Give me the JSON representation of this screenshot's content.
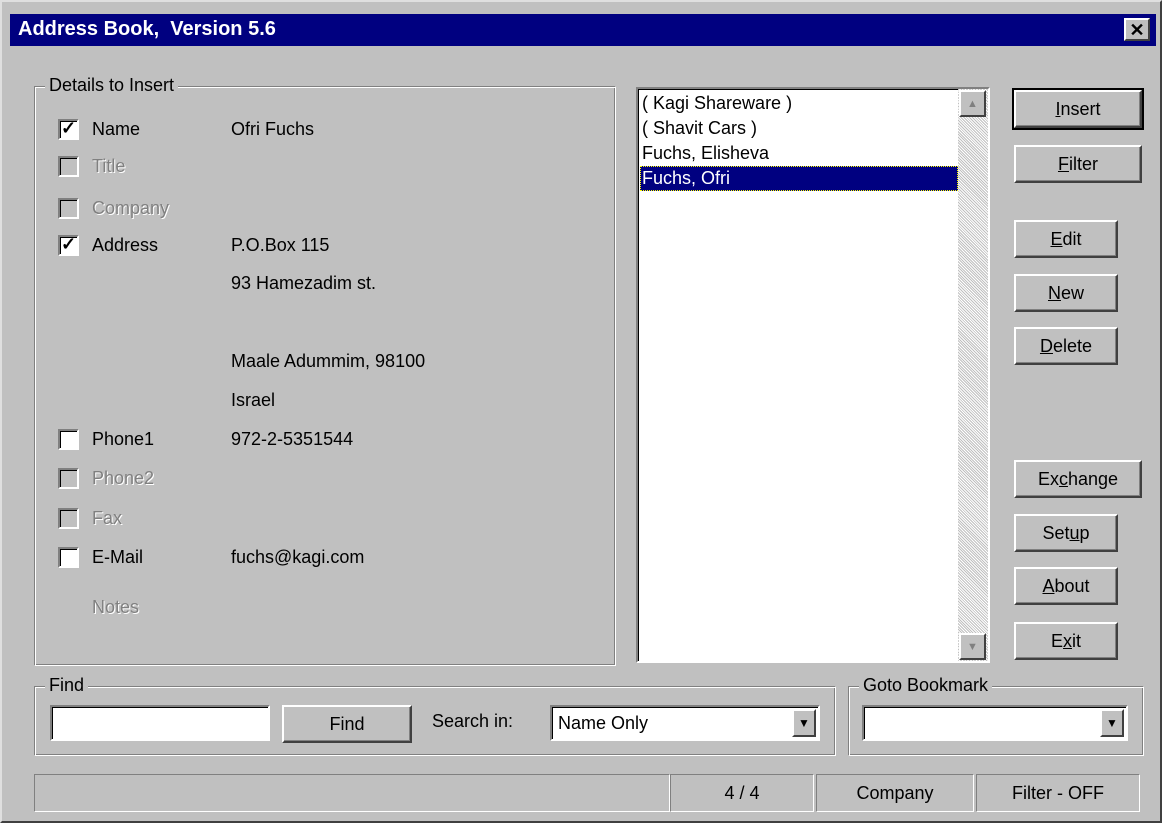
{
  "window": {
    "title": "Address Book,  Version 5.6",
    "close_glyph": "✕"
  },
  "details": {
    "legend": "Details to Insert",
    "fields": [
      {
        "label": "Name",
        "checked": true,
        "enabled": true,
        "value": "Ofri Fuchs"
      },
      {
        "label": "Title",
        "checked": false,
        "enabled": false,
        "value": ""
      },
      {
        "label": "Company",
        "checked": false,
        "enabled": false,
        "value": ""
      },
      {
        "label": "Address",
        "checked": true,
        "enabled": true,
        "value": "P.O.Box 115"
      },
      {
        "label": "Phone1",
        "checked": false,
        "enabled": true,
        "value": "972-2-5351544"
      },
      {
        "label": "Phone2",
        "checked": false,
        "enabled": false,
        "value": ""
      },
      {
        "label": "Fax",
        "checked": false,
        "enabled": false,
        "value": ""
      },
      {
        "label": "E-Mail",
        "checked": false,
        "enabled": true,
        "value": "fuchs@kagi.com"
      }
    ],
    "address_lines": [
      "93 Hamezadim st.",
      "Maale Adummim, 98100",
      "Israel"
    ],
    "notes_label": "Notes"
  },
  "contact_list": {
    "items": [
      "( Kagi Shareware )",
      "( Shavit Cars )",
      "Fuchs, Elisheva",
      "Fuchs, Ofri"
    ],
    "selected_index": 3
  },
  "buttons": {
    "insert": {
      "pre": "",
      "key": "I",
      "post": "nsert"
    },
    "filter": {
      "pre": "",
      "key": "F",
      "post": "ilter"
    },
    "edit": {
      "pre": "",
      "key": "E",
      "post": "dit"
    },
    "new": {
      "pre": "",
      "key": "N",
      "post": "ew"
    },
    "delete": {
      "pre": "",
      "key": "D",
      "post": "elete"
    },
    "exchange": {
      "pre": "Ex",
      "key": "c",
      "post": "hange"
    },
    "setup": {
      "pre": "Set",
      "key": "u",
      "post": "p"
    },
    "about": {
      "pre": "",
      "key": "A",
      "post": "bout"
    },
    "exit": {
      "pre": "E",
      "key": "x",
      "post": "it"
    }
  },
  "find": {
    "legend": "Find",
    "input_value": "",
    "button_label": "Find",
    "search_in_label": "Search in:",
    "search_in_value": "Name Only"
  },
  "goto": {
    "legend": "Goto Bookmark",
    "value": ""
  },
  "status": {
    "message": "",
    "position": "4 / 4",
    "sort_field": "Company",
    "filter": "Filter - OFF"
  }
}
